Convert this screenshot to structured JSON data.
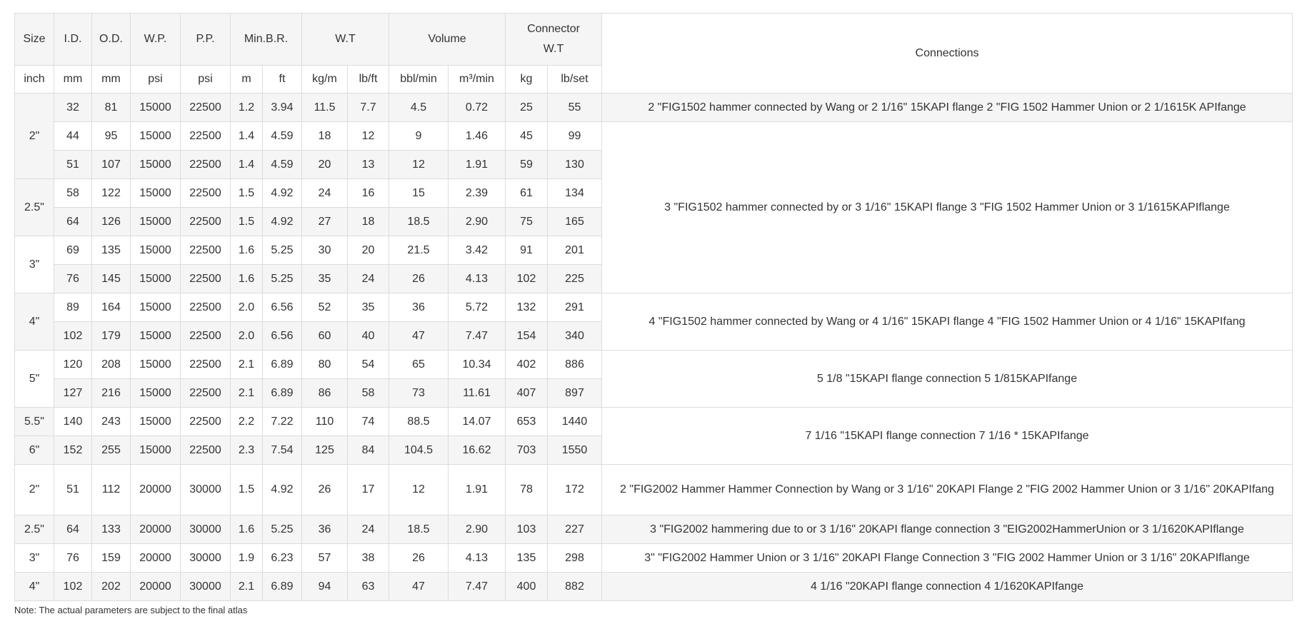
{
  "headers": {
    "size": "Size",
    "id": "I.D.",
    "od": "O.D.",
    "wp": "W.P.",
    "pp": "P.P.",
    "minbr": "Min.B.R.",
    "wt": "W.T",
    "volume": "Volume",
    "connector_wt": "Connector W.T",
    "connections": "Connections"
  },
  "units": [
    "inch",
    "mm",
    "mm",
    "psi",
    "psi",
    "m",
    "ft",
    "kg/m",
    "lb/ft",
    "bbl/min",
    "m³/min",
    "kg",
    "lb/set"
  ],
  "sizes": [
    "2\"",
    "2.5\"",
    "3\"",
    "4\"",
    "5\"",
    "5.5\"",
    "6\"",
    "2\"",
    "2.5\"",
    "3\"",
    "4\""
  ],
  "rows": [
    [
      "32",
      "81",
      "15000",
      "22500",
      "1.2",
      "3.94",
      "11.5",
      "7.7",
      "4.5",
      "0.72",
      "25",
      "55"
    ],
    [
      "44",
      "95",
      "15000",
      "22500",
      "1.4",
      "4.59",
      "18",
      "12",
      "9",
      "1.46",
      "45",
      "99"
    ],
    [
      "51",
      "107",
      "15000",
      "22500",
      "1.4",
      "4.59",
      "20",
      "13",
      "12",
      "1.91",
      "59",
      "130"
    ],
    [
      "58",
      "122",
      "15000",
      "22500",
      "1.5",
      "4.92",
      "24",
      "16",
      "15",
      "2.39",
      "61",
      "134"
    ],
    [
      "64",
      "126",
      "15000",
      "22500",
      "1.5",
      "4.92",
      "27",
      "18",
      "18.5",
      "2.90",
      "75",
      "165"
    ],
    [
      "69",
      "135",
      "15000",
      "22500",
      "1.6",
      "5.25",
      "30",
      "20",
      "21.5",
      "3.42",
      "91",
      "201"
    ],
    [
      "76",
      "145",
      "15000",
      "22500",
      "1.6",
      "5.25",
      "35",
      "24",
      "26",
      "4.13",
      "102",
      "225"
    ],
    [
      "89",
      "164",
      "15000",
      "22500",
      "2.0",
      "6.56",
      "52",
      "35",
      "36",
      "5.72",
      "132",
      "291"
    ],
    [
      "102",
      "179",
      "15000",
      "22500",
      "2.0",
      "6.56",
      "60",
      "40",
      "47",
      "7.47",
      "154",
      "340"
    ],
    [
      "120",
      "208",
      "15000",
      "22500",
      "2.1",
      "6.89",
      "80",
      "54",
      "65",
      "10.34",
      "402",
      "886"
    ],
    [
      "127",
      "216",
      "15000",
      "22500",
      "2.1",
      "6.89",
      "86",
      "58",
      "73",
      "11.61",
      "407",
      "897"
    ],
    [
      "140",
      "243",
      "15000",
      "22500",
      "2.2",
      "7.22",
      "110",
      "74",
      "88.5",
      "14.07",
      "653",
      "1440"
    ],
    [
      "152",
      "255",
      "15000",
      "22500",
      "2.3",
      "7.54",
      "125",
      "84",
      "104.5",
      "16.62",
      "703",
      "1550"
    ],
    [
      "51",
      "112",
      "20000",
      "30000",
      "1.5",
      "4.92",
      "26",
      "17",
      "12",
      "1.91",
      "78",
      "172"
    ],
    [
      "64",
      "133",
      "20000",
      "30000",
      "1.6",
      "5.25",
      "36",
      "24",
      "18.5",
      "2.90",
      "103",
      "227"
    ],
    [
      "76",
      "159",
      "20000",
      "30000",
      "1.9",
      "6.23",
      "57",
      "38",
      "26",
      "4.13",
      "135",
      "298"
    ],
    [
      "102",
      "202",
      "20000",
      "30000",
      "2.1",
      "6.89",
      "94",
      "63",
      "47",
      "7.47",
      "400",
      "882"
    ]
  ],
  "connections": [
    "2 \"FIG1502 hammer connected by Wang or 2 1/16\" 15KAPI flange 2 \"FIG 1502 Hammer Union or 2 1/1615K APIfange",
    "3 \"FIG1502 hammer connected by or 3 1/16\" 15KAPI flange 3 \"FIG 1502 Hammer Union or 3 1/1615KAPIflange",
    "4 \"FIG1502 hammer connected by Wang or 4 1/16\" 15KAPI flange 4 \"FIG 1502 Hammer Union or 4 1/16\" 15KAPIfang",
    "5 1/8 \"15KAPI flange connection 5 1/815KAPIfange",
    "7 1/16 \"15KAPI flange connection 7 1/16 * 15KAPIfange",
    "2 \"FIG2002 Hammer Hammer Connection by Wang or 3 1/16\" 20KAPI Flange 2 \"FIG 2002 Hammer Union or 3 1/16\" 20KAPIfang",
    "3 \"FIG2002 hammering due to or 3 1/16\" 20KAPI flange connection 3 \"EIG2002HammerUnion or 3 1/1620KAPIflange",
    "3\" \"FIG2002 Hammer Union or 3 1/16\" 20KAPI Flange Connection 3 \"FIG 2002 Hammer Union or 3 1/16\" 20KAPIflange",
    "4 1/16 \"20KAPI flange connection 4 1/1620KAPIfange"
  ],
  "note": "Note: The actual parameters are subject to the final atlas"
}
